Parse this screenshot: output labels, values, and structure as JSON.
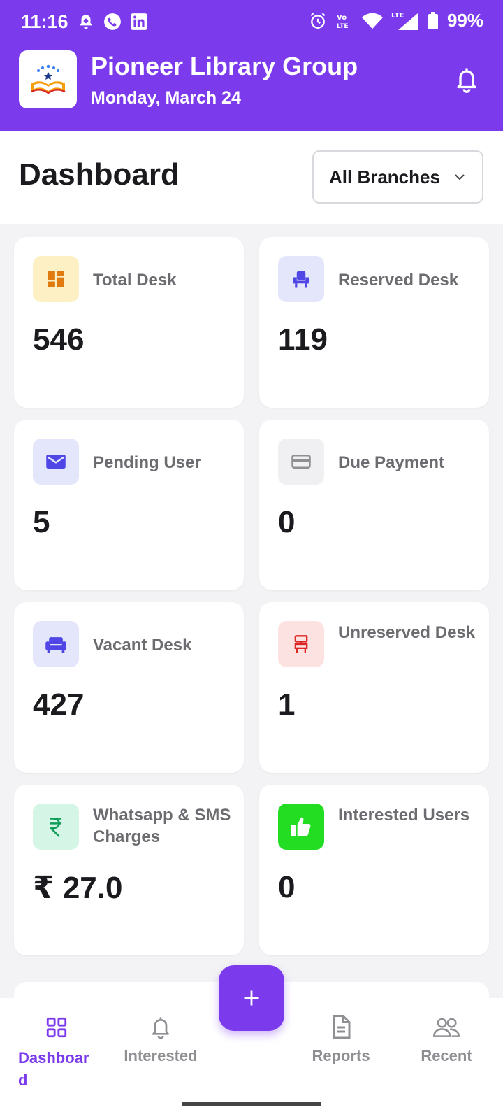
{
  "status_bar": {
    "time": "11:16",
    "battery": "99%",
    "network": "LTE"
  },
  "header": {
    "title": "Pioneer Library Group",
    "date": "Monday, March 24"
  },
  "page": {
    "title": "Dashboard",
    "branch_select": "All Branches"
  },
  "cards": [
    {
      "label": "Total Desk",
      "value": "546",
      "icon": "grid-squares-icon",
      "icon_bg": "#fdf0c4",
      "icon_color": "#e07b10"
    },
    {
      "label": "Reserved Desk",
      "value": "119",
      "icon": "chair-icon",
      "icon_bg": "#e4e6fb",
      "icon_color": "#4f46e5"
    },
    {
      "label": "Pending User",
      "value": "5",
      "icon": "mail-icon",
      "icon_bg": "#e4e6fb",
      "icon_color": "#4f46e5"
    },
    {
      "label": "Due Payment",
      "value": "0",
      "icon": "card-icon",
      "icon_bg": "#f0f0f2",
      "icon_color": "#8e8e93"
    },
    {
      "label": "Vacant Desk",
      "value": "427",
      "icon": "sofa-icon",
      "icon_bg": "#e4e6fb",
      "icon_color": "#4f46e5"
    },
    {
      "label": "Unreserved Desk",
      "value": "1",
      "icon": "stool-icon",
      "icon_bg": "#fde2e2",
      "icon_color": "#dc2626"
    },
    {
      "label": "Whatsapp & SMS Charges",
      "value": "₹ 27.0",
      "icon": "rupee-icon",
      "icon_bg": "#d5f5e6",
      "icon_color": "#0f9d58"
    },
    {
      "label": "Interested Users",
      "value": "0",
      "icon": "thumbs-up-icon",
      "icon_bg": "#22dd22",
      "icon_color": "#ffffff"
    }
  ],
  "bottom_nav": {
    "items": [
      {
        "label": "Dashboard",
        "icon": "dashboard-grid-icon",
        "active": true
      },
      {
        "label": "Interested",
        "icon": "bell-icon",
        "active": false
      },
      {
        "label": "Reports",
        "icon": "document-icon",
        "active": false
      },
      {
        "label": "Recent",
        "icon": "users-icon",
        "active": false
      }
    ],
    "fab_icon": "plus-icon"
  },
  "colors": {
    "accent": "#7c3aed",
    "text_dark": "#1b1b1f",
    "text_muted": "#6b6b70"
  }
}
